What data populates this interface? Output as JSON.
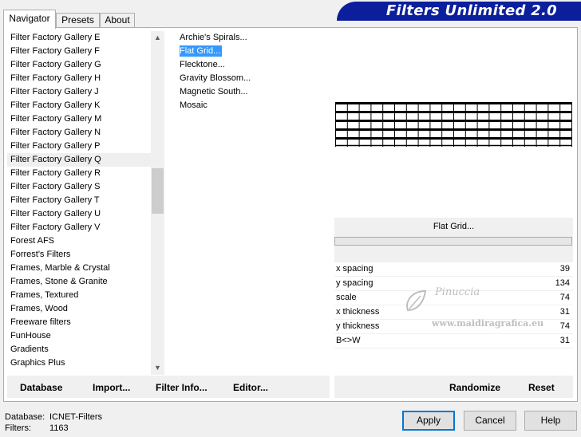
{
  "tabs": [
    "Navigator",
    "Presets",
    "About"
  ],
  "banner": {
    "title": "Filters Unlimited 2.0"
  },
  "categories": [
    "Filter Factory Gallery E",
    "Filter Factory Gallery F",
    "Filter Factory Gallery G",
    "Filter Factory Gallery H",
    "Filter Factory Gallery J",
    "Filter Factory Gallery K",
    "Filter Factory Gallery M",
    "Filter Factory Gallery N",
    "Filter Factory Gallery P",
    "Filter Factory Gallery Q",
    "Filter Factory Gallery R",
    "Filter Factory Gallery S",
    "Filter Factory Gallery T",
    "Filter Factory Gallery U",
    "Filter Factory Gallery V",
    "Forest AFS",
    "Forrest's Filters",
    "Frames, Marble & Crystal",
    "Frames, Stone & Granite",
    "Frames, Textured",
    "Frames, Wood",
    "Freeware filters",
    "FunHouse",
    "Gradients",
    "Graphics Plus"
  ],
  "selected_category": "Filter Factory Gallery Q",
  "filters": [
    "Archie's Spirals...",
    "Flat Grid...",
    "Flecktone...",
    "Gravity Blossom...",
    "Magnetic South...",
    "Mosaic"
  ],
  "selected_filter": "Flat Grid...",
  "preview": {
    "filter_title": "Flat Grid..."
  },
  "params": [
    {
      "name": "x spacing",
      "value": "39"
    },
    {
      "name": "y spacing",
      "value": "134"
    },
    {
      "name": "scale",
      "value": "74"
    },
    {
      "name": "x thickness",
      "value": "31"
    },
    {
      "name": "y thickness",
      "value": "74"
    },
    {
      "name": "B<>W",
      "value": "31"
    }
  ],
  "watermark": {
    "line1": "Pinuccia",
    "line2": "www.maidiragrafica.eu"
  },
  "toolbar": {
    "database": "Database",
    "import": "Import...",
    "filter_info": "Filter Info...",
    "editor": "Editor...",
    "randomize": "Randomize",
    "reset": "Reset"
  },
  "status": {
    "database_label": "Database:",
    "database_value": "ICNET-Filters",
    "filters_label": "Filters:",
    "filters_value": "1163"
  },
  "buttons": {
    "apply": "Apply",
    "cancel": "Cancel",
    "help": "Help"
  },
  "colors": {
    "banner": "#0b1f9c",
    "selection": "#3399ff",
    "default_button_border": "#0078d7"
  }
}
